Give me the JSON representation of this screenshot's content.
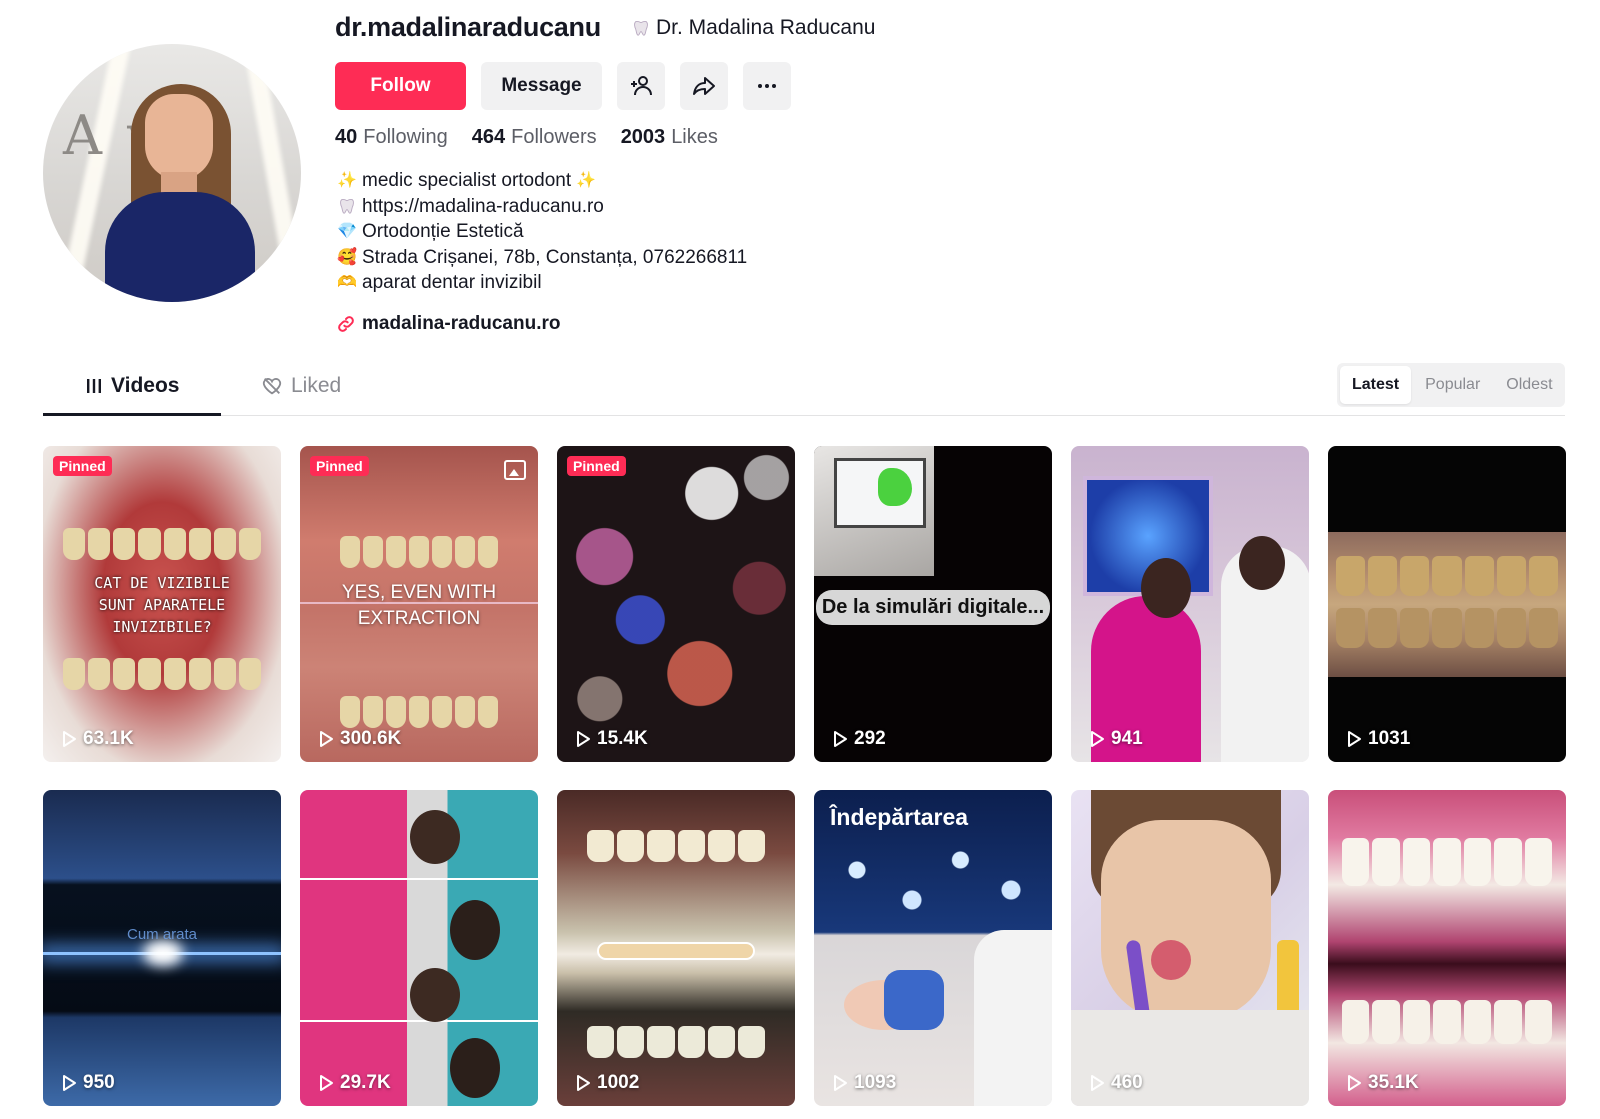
{
  "profile": {
    "username": "dr.madalinaraducanu",
    "nickname": "Dr. Madalina Raducanu",
    "buttons": {
      "follow": "Follow",
      "message": "Message"
    },
    "stats": [
      {
        "value": "40",
        "label": "Following"
      },
      {
        "value": "464",
        "label": "Followers"
      },
      {
        "value": "2003",
        "label": "Likes"
      }
    ],
    "bio": [
      {
        "emoji": "✨",
        "text": "medic specialist ortodont",
        "emoji_end": "✨"
      },
      {
        "emoji": "tooth",
        "text": "https://madalina-raducanu.ro"
      },
      {
        "emoji": "💎",
        "text": "Ortodonție Estetică"
      },
      {
        "emoji": "🥰",
        "text": "Strada Crișanei, 78b, Constanța, 0762266811"
      },
      {
        "emoji": "🫶",
        "text": "aparat dentar invizibil"
      }
    ],
    "link": "madalina-raducanu.ro"
  },
  "tabs": {
    "videos": "Videos",
    "liked": "Liked"
  },
  "sort": {
    "latest": "Latest",
    "popular": "Popular",
    "oldest": "Oldest",
    "selected": "Latest"
  },
  "videos": [
    {
      "views": "63.1K",
      "pinned": "Pinned",
      "caption": "CAT DE VIZIBILE SUNT APARATELE INVIZIBILE?"
    },
    {
      "views": "300.6K",
      "pinned": "Pinned",
      "caption": "YES, EVEN WITH EXTRACTION"
    },
    {
      "views": "15.4K",
      "pinned": "Pinned",
      "caption": ""
    },
    {
      "views": "292",
      "pinned": "",
      "caption": "De la simulări digitale..."
    },
    {
      "views": "941",
      "pinned": "",
      "caption": ""
    },
    {
      "views": "1031",
      "pinned": "",
      "caption": ""
    },
    {
      "views": "950",
      "pinned": "",
      "caption": "Cum arata"
    },
    {
      "views": "29.7K",
      "pinned": "",
      "caption": ""
    },
    {
      "views": "1002",
      "pinned": "",
      "caption": ""
    },
    {
      "views": "1093",
      "pinned": "",
      "caption": "Îndepărtarea"
    },
    {
      "views": "460",
      "pinned": "",
      "caption": ""
    },
    {
      "views": "35.1K",
      "pinned": "",
      "caption": ""
    }
  ],
  "colors": {
    "accent": "#fe2c55",
    "text": "#161823",
    "muted": "#8a8b91"
  }
}
